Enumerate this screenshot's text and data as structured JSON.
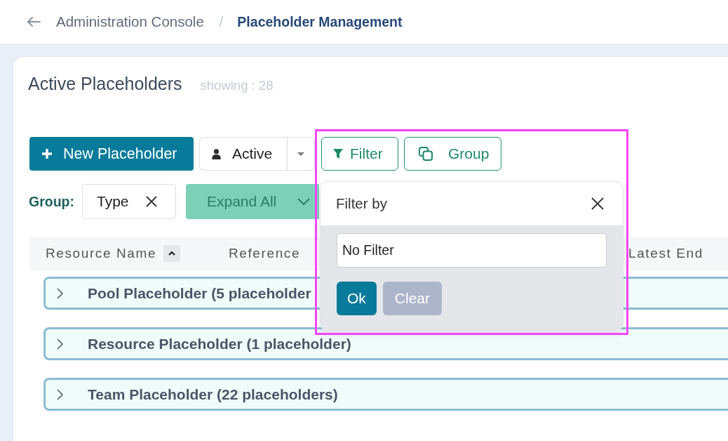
{
  "breadcrumb": {
    "separator": "/",
    "items": [
      {
        "label": "Administration Console",
        "current": false
      },
      {
        "label": "Placeholder Management",
        "current": true
      }
    ]
  },
  "page": {
    "title": "Active Placeholders",
    "count": "showing : 28"
  },
  "toolbar": {
    "new_button": "New Placeholder",
    "status_filter": "Active",
    "filter_button": "Filter",
    "group_button": "Group"
  },
  "grouping": {
    "label": "Group:",
    "chips": [
      {
        "label": "Type"
      }
    ],
    "expand_button": "Expand All"
  },
  "table": {
    "columns": [
      {
        "label": "Resource Name",
        "sorted": true
      },
      {
        "label": "Reference",
        "sorted": false
      },
      {
        "label": "Latest End",
        "sorted": false
      }
    ],
    "groups": [
      {
        "label": "Pool Placeholder (5 placeholder",
        "expanded": false
      },
      {
        "label": "Resource Placeholder (1 placeholder)",
        "expanded": false
      },
      {
        "label": "Team Placeholder (22 placeholders)",
        "expanded": false
      }
    ]
  },
  "filter_popup": {
    "title": "Filter by",
    "field": {
      "value": "No Filter"
    },
    "buttons": [
      {
        "label": "Ok",
        "disabled": false
      },
      {
        "label": "Clear",
        "disabled": true
      }
    ]
  }
}
